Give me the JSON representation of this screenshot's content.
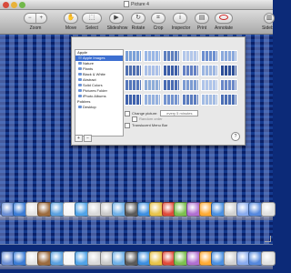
{
  "window": {
    "title": "Picture 4"
  },
  "toolbar": {
    "zoom_label": "Zoom",
    "move_label": "Move",
    "select_label": "Select",
    "slideshow_label": "Slideshow",
    "rotate_label": "Rotate",
    "crop_label": "Crop",
    "inspector_label": "Inspector",
    "print_label": "Print",
    "annotate_label": "Annotate",
    "sidebar_label": "Sideb"
  },
  "sheet": {
    "groups": [
      {
        "label": "Apple"
      },
      {
        "label": "Folders"
      }
    ],
    "apple_items": [
      {
        "label": "Apple Images",
        "selected": true
      },
      {
        "label": "Nature"
      },
      {
        "label": "Plants"
      },
      {
        "label": "Black & White"
      },
      {
        "label": "Abstract"
      },
      {
        "label": "Solid Colors"
      },
      {
        "label": "Pictures Folder"
      },
      {
        "label": "iPhoto Albums"
      }
    ],
    "folder_items": [
      {
        "label": "Desktop"
      }
    ],
    "controls": [
      "+",
      "−"
    ],
    "change_picture_label": "Change picture:",
    "change_picture_value": "every 5 minutes",
    "random_order_label": "Random order",
    "translucent_menu_bar_label": "Translucent Menu Bar",
    "help": "?",
    "thumb_colors": [
      "#7aa0d8",
      "#9ab7e6",
      "#5e7fbf",
      "#b3c7ea",
      "#6d8fd0",
      "#8aa9dd",
      "#4f6fb0",
      "#aac0e8",
      "#3c5ea8",
      "#6380c4",
      "#9cb6e2",
      "#2d4f98",
      "#5577bb",
      "#8eadd9",
      "#4a6cb3",
      "#7c9bd2",
      "#b0c5ea",
      "#6a88c8",
      "#3f62ad",
      "#95b1df",
      "#7393cf",
      "#5b7cbf",
      "#a3bce4",
      "#4c6fb5"
    ]
  },
  "dock_colors": [
    "#6b8fd6",
    "#3a7bd5",
    "#e3e3e3",
    "#9c6b3e",
    "#5aa0e0",
    "#f5f5f5",
    "#4fa3e8",
    "#d9d9d9",
    "#c9c9c9",
    "#6fb0e8",
    "#5a5a5a",
    "#3c8ee0",
    "#e8c34a",
    "#e04a3a",
    "#7cc04f",
    "#b06fd1",
    "#ffaa33",
    "#4a90e2",
    "#d0d0d0",
    "#88aaee",
    "#5588dd",
    "#e0e0e0"
  ]
}
